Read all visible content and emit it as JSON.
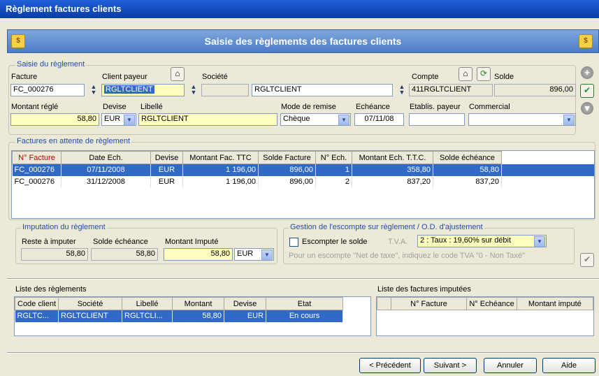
{
  "window": {
    "title": "Règlement factures clients"
  },
  "banner": {
    "title": "Saisie des règlements des factures clients",
    "icon": "coins-icon"
  },
  "saisie": {
    "group_label": "Saisie du règlement",
    "facture_label": "Facture",
    "facture_value": "FC_000276",
    "client_label": "Client payeur",
    "client_value": "RGLTCLIENT",
    "societe_label": "Société",
    "societe_value": "RGLTCLIENT",
    "compte_label": "Compte",
    "compte_value": "411RGLTCLIENT",
    "solde_label": "Solde",
    "solde_value": "896,00",
    "montant_label": "Montant réglé",
    "montant_value": "58,80",
    "devise_label": "Devise",
    "devise_value": "EUR",
    "libelle_label": "Libellé",
    "libelle_value": "RGLTCLIENT",
    "mode_label": "Mode de remise",
    "mode_value": "Chèque",
    "echeance_label": "Echéance",
    "echeance_value": "07/11/08",
    "etablis_label": "Etablis. payeur",
    "etablis_value": "",
    "commercial_label": "Commercial",
    "commercial_value": ""
  },
  "factures": {
    "group_label": "Factures en attente de règlement",
    "columns": [
      "N° Facture",
      "Date Ech.",
      "Devise",
      "Montant Fac. TTC",
      "Solde Facture",
      "N° Ech.",
      "Montant Ech. T.T.C.",
      "Solde échéance"
    ],
    "rows": [
      [
        "FC_000276",
        "07/11/2008",
        "EUR",
        "1 196,00",
        "896,00",
        "1",
        "358,80",
        "58,80"
      ],
      [
        "FC_000276",
        "31/12/2008",
        "EUR",
        "1 196,00",
        "896,00",
        "2",
        "837,20",
        "837,20"
      ]
    ]
  },
  "imputation": {
    "group_label": "Imputation du règlement",
    "reste_label": "Reste à imputer",
    "reste_value": "58,80",
    "solde_label": "Solde échéance",
    "solde_value": "58,80",
    "montant_label": "Montant Imputé",
    "montant_value": "58,80",
    "devise_value": "EUR"
  },
  "escompte": {
    "group_label": "Gestion de l'escompte sur règlement / O.D. d'ajustement",
    "checkbox_label": "Escompter le solde",
    "tva_label": "T.V.A.",
    "tva_value": "2 : Taux : 19,60% sur débit",
    "hint": "Pour un escompte \"Net de taxe\", indiquez le code TVA \"0 - Non Taxé\""
  },
  "reglements": {
    "title": "Liste des règlements",
    "columns": [
      "Code client",
      "Société",
      "Libellé",
      "Montant",
      "Devise",
      "Etat"
    ],
    "rows": [
      [
        "RGLTC...",
        "RGLTCLIENT",
        "RGLTCLI...",
        "58,80",
        "EUR",
        "En cours"
      ]
    ]
  },
  "imputees": {
    "title": "Liste des factures imputées",
    "columns": [
      "N° Facture",
      "N° Echéance",
      "Montant imputé"
    ]
  },
  "buttons": {
    "prev": "< Précédent",
    "next": "Suivant >",
    "cancel": "Annuler",
    "help": "Aide"
  },
  "colors": {
    "title_bar": "#0a3ca8",
    "selection": "#3169c6",
    "highlight_field": "#ffffc0",
    "group_label": "#1f4ea8"
  }
}
